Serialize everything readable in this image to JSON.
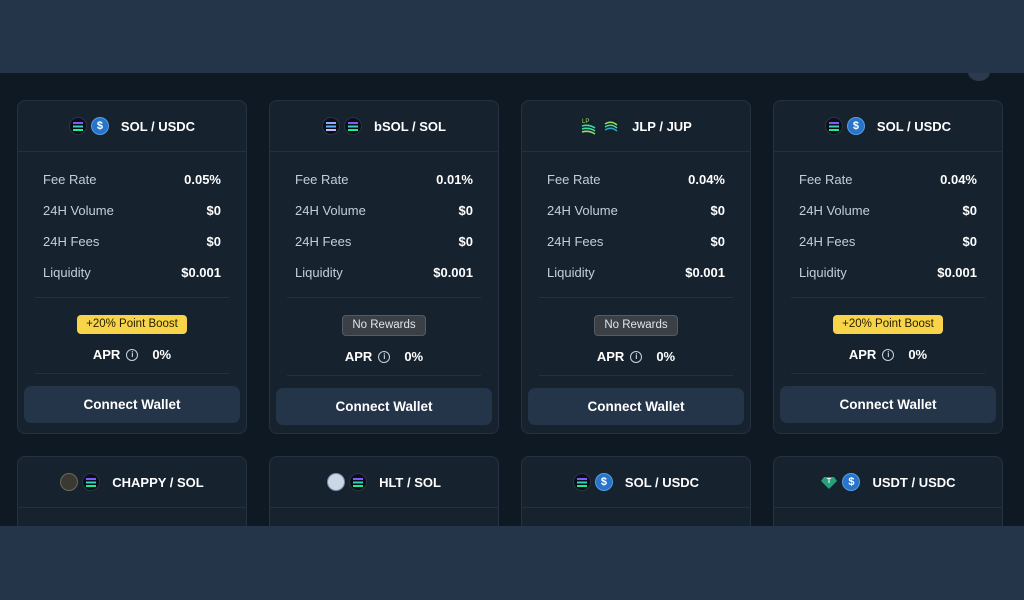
{
  "pools": [
    {
      "pair": "SOL / USDC",
      "icons": [
        "sol-icon",
        "usdc-icon"
      ],
      "stats": [
        {
          "label": "Fee Rate",
          "value": "0.05%"
        },
        {
          "label": "24H Volume",
          "value": "$0"
        },
        {
          "label": "24H Fees",
          "value": "$0"
        },
        {
          "label": "Liquidity",
          "value": "$0.001"
        }
      ],
      "reward": "+20% Point Boost",
      "apr_label": "APR",
      "apr": "0%",
      "button": "Connect Wallet"
    },
    {
      "pair": "bSOL / SOL",
      "icons": [
        "bsol-icon",
        "sol-icon"
      ],
      "stats": [
        {
          "label": "Fee Rate",
          "value": "0.01%"
        },
        {
          "label": "24H Volume",
          "value": "$0"
        },
        {
          "label": "24H Fees",
          "value": "$0"
        },
        {
          "label": "Liquidity",
          "value": "$0.001"
        }
      ],
      "reward": "No Rewards",
      "apr_label": "APR",
      "apr": "0%",
      "button": "Connect Wallet"
    },
    {
      "pair": "JLP / JUP",
      "icons": [
        "jlp-icon",
        "jup-icon"
      ],
      "stats": [
        {
          "label": "Fee Rate",
          "value": "0.04%"
        },
        {
          "label": "24H Volume",
          "value": "$0"
        },
        {
          "label": "24H Fees",
          "value": "$0"
        },
        {
          "label": "Liquidity",
          "value": "$0.001"
        }
      ],
      "reward": "No Rewards",
      "apr_label": "APR",
      "apr": "0%",
      "button": "Connect Wallet"
    },
    {
      "pair": "SOL / USDC",
      "icons": [
        "sol-icon",
        "usdc-icon"
      ],
      "stats": [
        {
          "label": "Fee Rate",
          "value": "0.04%"
        },
        {
          "label": "24H Volume",
          "value": "$0"
        },
        {
          "label": "24H Fees",
          "value": "$0"
        },
        {
          "label": "Liquidity",
          "value": "$0.001"
        }
      ],
      "reward": "+20% Point Boost",
      "apr_label": "APR",
      "apr": "0%",
      "button": "Connect Wallet"
    }
  ],
  "pools_row2": [
    {
      "pair": "CHAPPY / SOL",
      "icons": [
        "chappy-icon",
        "sol-icon"
      ]
    },
    {
      "pair": "HLT / SOL",
      "icons": [
        "hlt-icon",
        "sol-icon"
      ]
    },
    {
      "pair": "SOL / USDC",
      "icons": [
        "sol-icon",
        "usdc-icon"
      ]
    },
    {
      "pair": "USDT / USDC",
      "icons": [
        "usdt-icon",
        "usdc-icon"
      ]
    }
  ],
  "colors": {
    "boost": "#f7d44a",
    "no_rewards": "#3b3f46",
    "button": "#243449",
    "card": "#17222f",
    "page": "#0f1923"
  }
}
